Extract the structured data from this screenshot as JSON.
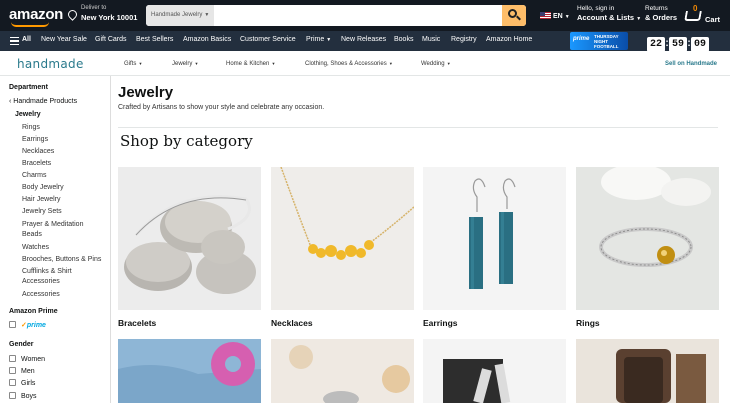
{
  "header": {
    "logo": "amazon",
    "deliver_line1": "Deliver to",
    "deliver_line2": "New York 10001",
    "search_dept": "Handmade Jewelry",
    "search_value": "",
    "search_placeholder": "",
    "lang": "EN",
    "account_line1": "Hello, sign in",
    "account_line2": "Account & Lists",
    "returns_line1": "Returns",
    "returns_line2": "& Orders",
    "cart_count": "0",
    "cart_label": "Cart"
  },
  "subnav": {
    "all": "All",
    "items": [
      "New Year Sale",
      "Gift Cards",
      "Best Sellers",
      "Amazon Basics",
      "Customer Service",
      "Prime",
      "New Releases",
      "Books",
      "Music",
      "Registry",
      "Amazon Home"
    ],
    "promo_prime": "prime",
    "promo_text": "THURSDAY NIGHT FOOTBALL",
    "timer": [
      "22",
      "59",
      "09"
    ]
  },
  "handmade": {
    "logo": "handmade",
    "menu": [
      "Gifts",
      "Jewelry",
      "Home & Kitchen",
      "Clothing, Shoes & Accessories",
      "Wedding"
    ],
    "sell": "Sell on Handmade"
  },
  "sidebar": {
    "department_heading": "Department",
    "back_link": "‹ Handmade Products",
    "current": "Jewelry",
    "subcategories": [
      "Rings",
      "Earrings",
      "Necklaces",
      "Bracelets",
      "Charms",
      "Body Jewelry",
      "Hair Jewelry",
      "Jewelry Sets",
      "Prayer & Meditation",
      "Beads",
      "Watches",
      "Brooches, Buttons & Pins",
      "Cufflinks & Shirt",
      "Accessories",
      "Accessories"
    ],
    "prime_heading": "Amazon Prime",
    "prime_label": "prime",
    "gender_heading": "Gender",
    "genders": [
      "Women",
      "Men",
      "Girls",
      "Boys"
    ]
  },
  "main": {
    "title": "Jewelry",
    "subtitle": "Crafted by Artisans to show your style and celebrate any occasion.",
    "section_heading": "Shop by category",
    "categories": [
      "Bracelets",
      "Necklaces",
      "Earrings",
      "Rings"
    ]
  },
  "colors": {
    "nav_dark": "#131921",
    "nav_sub": "#232f3e",
    "search_button": "#febd69",
    "handmade_teal": "#2a7a8c"
  }
}
